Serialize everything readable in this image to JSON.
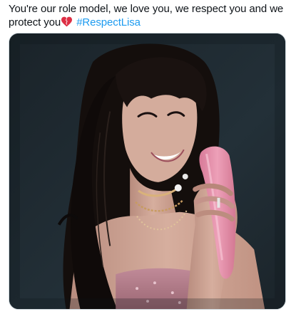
{
  "tweet": {
    "text": "You're our role model, we love you, we respect you and we protect you",
    "emoji": "heart-icon",
    "hashtag": "#RespectLisa",
    "media": {
      "kind": "photo",
      "colors": {
        "background": "#1e2a30",
        "hair": "#16100e",
        "skin": "#c8a090",
        "microphone": "#e08aa5",
        "top": "#b47f8c"
      }
    }
  }
}
